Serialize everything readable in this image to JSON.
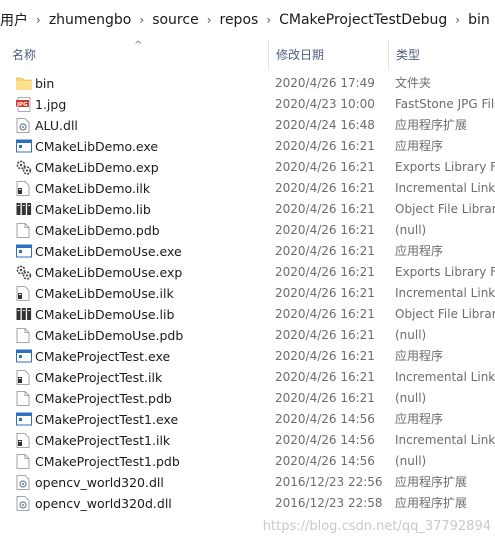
{
  "breadcrumb": [
    "用户",
    "zhumengbo",
    "source",
    "repos",
    "CMakeProjectTestDebug",
    "bin"
  ],
  "columns": {
    "name": "名称",
    "date": "修改日期",
    "type": "类型"
  },
  "files": [
    {
      "name": "bin",
      "date": "2020/4/26 17:49",
      "type": "文件夹",
      "icon": "folder-icon"
    },
    {
      "name": "1.jpg",
      "date": "2020/4/23 10:00",
      "type": "FastStone JPG File",
      "icon": "jpg-file-icon"
    },
    {
      "name": "ALU.dll",
      "date": "2020/4/24 16:48",
      "type": "应用程序扩展",
      "icon": "dll-file-icon"
    },
    {
      "name": "CMakeLibDemo.exe",
      "date": "2020/4/26 16:21",
      "type": "应用程序",
      "icon": "exe-file-icon"
    },
    {
      "name": "CMakeLibDemo.exp",
      "date": "2020/4/26 16:21",
      "type": "Exports Library File",
      "icon": "exp-file-icon"
    },
    {
      "name": "CMakeLibDemo.ilk",
      "date": "2020/4/26 16:21",
      "type": "Incremental Linker File",
      "icon": "ilk-file-icon"
    },
    {
      "name": "CMakeLibDemo.lib",
      "date": "2020/4/26 16:21",
      "type": "Object File Library",
      "icon": "lib-file-icon"
    },
    {
      "name": "CMakeLibDemo.pdb",
      "date": "2020/4/26 16:21",
      "type": "(null)",
      "icon": "blank-file-icon"
    },
    {
      "name": "CMakeLibDemoUse.exe",
      "date": "2020/4/26 16:21",
      "type": "应用程序",
      "icon": "exe-file-icon"
    },
    {
      "name": "CMakeLibDemoUse.exp",
      "date": "2020/4/26 16:21",
      "type": "Exports Library File",
      "icon": "exp-file-icon"
    },
    {
      "name": "CMakeLibDemoUse.ilk",
      "date": "2020/4/26 16:21",
      "type": "Incremental Linker File",
      "icon": "ilk-file-icon"
    },
    {
      "name": "CMakeLibDemoUse.lib",
      "date": "2020/4/26 16:21",
      "type": "Object File Library",
      "icon": "lib-file-icon"
    },
    {
      "name": "CMakeLibDemoUse.pdb",
      "date": "2020/4/26 16:21",
      "type": "(null)",
      "icon": "blank-file-icon"
    },
    {
      "name": "CMakeProjectTest.exe",
      "date": "2020/4/26 16:21",
      "type": "应用程序",
      "icon": "exe-file-icon"
    },
    {
      "name": "CMakeProjectTest.ilk",
      "date": "2020/4/26 16:21",
      "type": "Incremental Linker File",
      "icon": "ilk-file-icon"
    },
    {
      "name": "CMakeProjectTest.pdb",
      "date": "2020/4/26 16:21",
      "type": "(null)",
      "icon": "blank-file-icon"
    },
    {
      "name": "CMakeProjectTest1.exe",
      "date": "2020/4/26 14:56",
      "type": "应用程序",
      "icon": "exe-file-icon"
    },
    {
      "name": "CMakeProjectTest1.ilk",
      "date": "2020/4/26 14:56",
      "type": "Incremental Linker File",
      "icon": "ilk-file-icon"
    },
    {
      "name": "CMakeProjectTest1.pdb",
      "date": "2020/4/26 14:56",
      "type": "(null)",
      "icon": "blank-file-icon"
    },
    {
      "name": "opencv_world320.dll",
      "date": "2016/12/23 22:56",
      "type": "应用程序扩展",
      "icon": "dll-file-icon"
    },
    {
      "name": "opencv_world320d.dll",
      "date": "2016/12/23 22:58",
      "type": "应用程序扩展",
      "icon": "dll-file-icon"
    }
  ],
  "watermark": "https://blog.csdn.net/qq_37792894",
  "colors": {
    "header_text": "#4d6082",
    "secondary_text": "#6d6d6d",
    "folder": "#f8d775",
    "exe_blue": "#2f6fbf"
  }
}
